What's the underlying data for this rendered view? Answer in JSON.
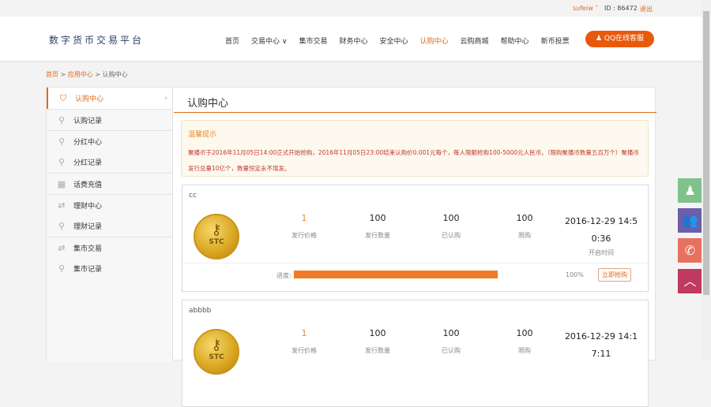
{
  "topbar": {
    "user": "sufeiw",
    "id_label": "ID : 86472",
    "logout": "退出"
  },
  "header": {
    "logo": "数字货币交易平台",
    "nav": [
      "首页",
      "交易中心 ∨",
      "集市交易",
      "财务中心",
      "安全中心",
      "认购中心",
      "云购商城",
      "帮助中心",
      "新币投票"
    ],
    "active_nav": 5,
    "qq_button": "QQ在线客服"
  },
  "breadcrumb": {
    "home": "首页",
    "app": "应用中心",
    "current": "认购中心",
    "sep": " > "
  },
  "sidebar": {
    "items": [
      {
        "label": "认购中心",
        "icon": "shield-icon"
      },
      {
        "label": "认购记录",
        "icon": "search-icon"
      },
      {
        "label": "分红中心",
        "icon": "search-plus-icon"
      },
      {
        "label": "分红记录",
        "icon": "search-icon"
      },
      {
        "label": "话费充值",
        "icon": "calendar-icon"
      },
      {
        "label": "理财中心",
        "icon": "exchange-icon"
      },
      {
        "label": "理财记录",
        "icon": "search-icon"
      },
      {
        "label": "集市交易",
        "icon": "exchange-icon"
      },
      {
        "label": "集市记录",
        "icon": "search-icon"
      }
    ]
  },
  "main": {
    "title": "认购中心",
    "notice": {
      "title": "温馨提示",
      "body": "聚播币于2016年11月05日14:00正式开始抢购，2016年11月05日23:00结束认购价0.001元每个，每人限额抢购100-5000元人民币。（限购聚播币数量五百万个）聚播币发行总量10亿个，数量恒定永不增发。"
    },
    "labels": {
      "price": "发行价格",
      "qty": "发行数量",
      "sold": "已认购",
      "limit": "限购",
      "time": "开启时间",
      "progress": "进度:",
      "buy": "立即抢购",
      "coin": "STC"
    },
    "cards": [
      {
        "name": "cc",
        "price": "1",
        "qty": "100",
        "sold": "100",
        "limit": "100",
        "time1": "2016-12-29 14:5",
        "time2": "0:36",
        "progress_pct": "100%",
        "progress": 1.0
      },
      {
        "name": "abbbb",
        "price": "1",
        "qty": "100",
        "sold": "100",
        "limit": "100",
        "time1": "2016-12-29 14:1",
        "time2": "7:11"
      }
    ]
  },
  "float_buttons": [
    {
      "icon": "qq-icon",
      "color": "#7fc28b"
    },
    {
      "icon": "users-icon",
      "color": "#6a5fa8"
    },
    {
      "icon": "phone-icon",
      "color": "#e8705f"
    },
    {
      "icon": "back-to-top-icon",
      "color": "#c0395e"
    }
  ]
}
